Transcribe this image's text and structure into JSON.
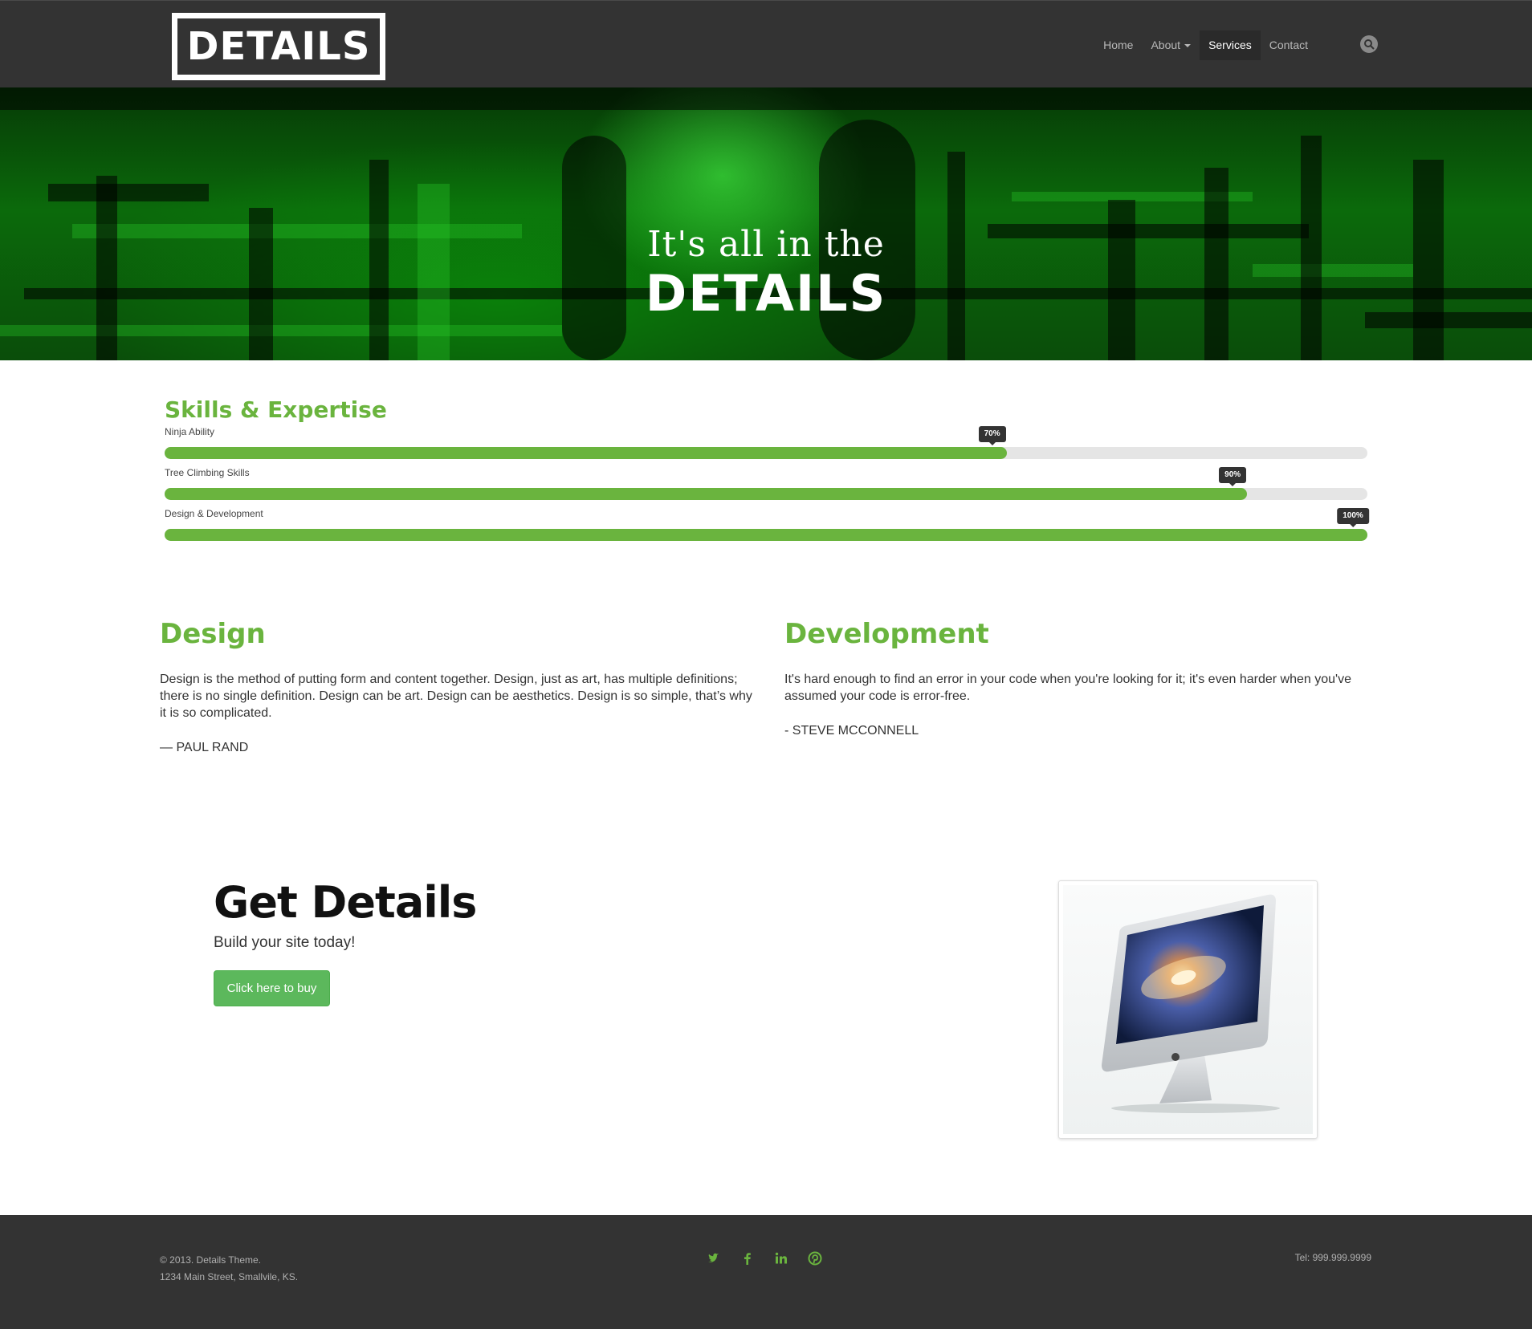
{
  "brand": {
    "logo_text": "DETAILS",
    "accent_color": "#6ab43e",
    "dark_color": "#333333"
  },
  "nav": {
    "items": [
      {
        "label": "Home"
      },
      {
        "label": "About"
      },
      {
        "label": "Services"
      },
      {
        "label": "Contact"
      }
    ],
    "active": "Services",
    "search_icon": "search-icon"
  },
  "hero": {
    "line1": "It's all in the",
    "line2": "DETAILS"
  },
  "skills": {
    "title": "Skills & Expertise",
    "items": [
      {
        "label": "Ninja Ability",
        "percent": 70,
        "tooltip": "70%"
      },
      {
        "label": "Tree Climbing Skills",
        "percent": 90,
        "tooltip": "90%"
      },
      {
        "label": "Design & Development",
        "percent": 100,
        "tooltip": "100%"
      }
    ]
  },
  "design": {
    "title": "Design",
    "text": "Design is the method of putting form and content together. Design, just as art, has multiple definitions; there is no single definition. Design can be art. Design can be aesthetics. Design is so simple, that’s why it is so complicated.",
    "cite": "— PAUL RAND"
  },
  "development": {
    "title": "Development",
    "text": "It's hard enough to find an error in your code when you're looking for it; it's even harder when you've assumed your code is error-free.",
    "cite": "- STEVE MCCONNELL"
  },
  "cta": {
    "title": "Get Details",
    "subtitle": "Build your site today!",
    "button": "Click here to buy"
  },
  "footer": {
    "copyright": "© 2013. Details Theme.",
    "address": "1234 Main Street, Smallvile, KS.",
    "phone": "Tel: 999.999.9999",
    "social_icons": [
      "twitter-icon",
      "facebook-icon",
      "linkedin-icon",
      "pinterest-icon"
    ]
  }
}
